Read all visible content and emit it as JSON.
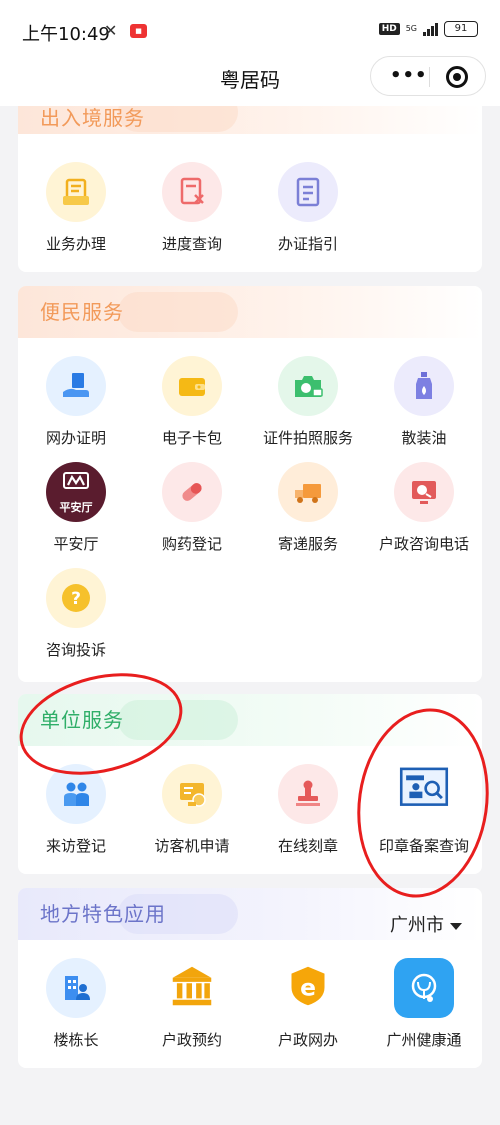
{
  "status_bar": {
    "time": "上午10:49",
    "network": "5G",
    "battery": "91",
    "hd": "HD"
  },
  "navbar": {
    "title": "粤居码"
  },
  "sections": {
    "entry_exit": {
      "title": "出入境服务",
      "items": [
        {
          "label": "业务办理",
          "icon": "document-tray-icon"
        },
        {
          "label": "进度查询",
          "icon": "document-x-icon"
        },
        {
          "label": "办证指引",
          "icon": "guide-document-icon"
        }
      ]
    },
    "public_service": {
      "title": "便民服务",
      "items": [
        {
          "label": "网办证明",
          "icon": "hand-certificate-icon"
        },
        {
          "label": "电子卡包",
          "icon": "wallet-icon"
        },
        {
          "label": "证件拍照服务",
          "icon": "camera-id-icon"
        },
        {
          "label": "散装油",
          "icon": "oil-bottle-icon"
        },
        {
          "label": "平安厅",
          "icon": "pingan-hall-logo",
          "logo_text": "平安厅"
        },
        {
          "label": "购药登记",
          "icon": "pill-capsule-icon"
        },
        {
          "label": "寄递服务",
          "icon": "delivery-truck-icon"
        },
        {
          "label": "户政咨询电话",
          "icon": "phone-screen-icon"
        },
        {
          "label": "咨询投诉",
          "icon": "question-icon"
        }
      ]
    },
    "unit_service": {
      "title": "单位服务",
      "items": [
        {
          "label": "来访登记",
          "icon": "visitors-icon"
        },
        {
          "label": "访客机申请",
          "icon": "visitor-machine-icon"
        },
        {
          "label": "在线刻章",
          "icon": "stamp-icon"
        },
        {
          "label": "印章备案查询",
          "icon": "seal-search-icon"
        }
      ]
    },
    "local_apps": {
      "title": "地方特色应用",
      "city": "广州市",
      "items": [
        {
          "label": "楼栋长",
          "icon": "building-person-icon"
        },
        {
          "label": "户政预约",
          "icon": "government-building-icon"
        },
        {
          "label": "户政网办",
          "icon": "e-shield-icon"
        },
        {
          "label": "广州健康通",
          "icon": "health-stethoscope-icon"
        }
      ]
    }
  },
  "colors": {
    "orange_header": "#f29a5a",
    "green_header": "#2fae68",
    "purple_header": "#6c74c9",
    "annotation": "#e81e1e"
  }
}
